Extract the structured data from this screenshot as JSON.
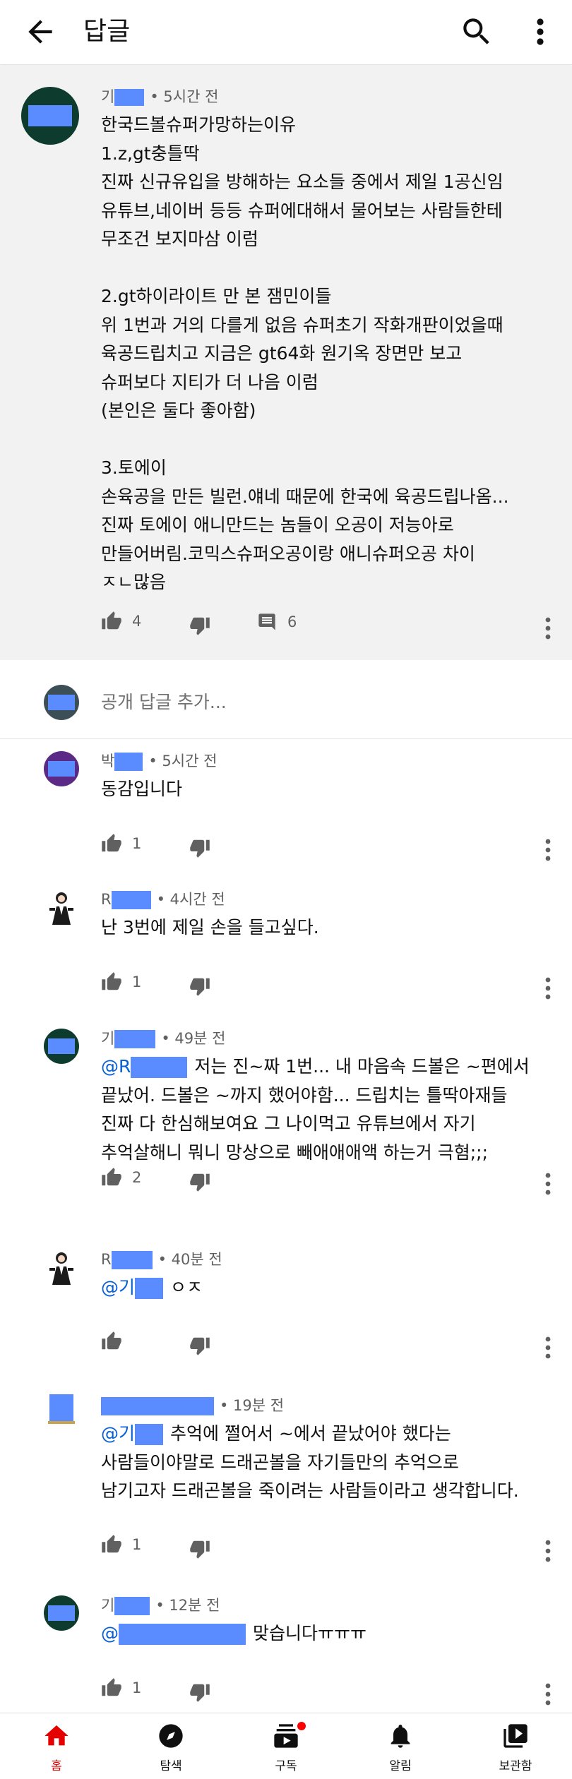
{
  "header": {
    "title": "답글"
  },
  "main_comment": {
    "author": "기",
    "time": "• 5시간 전",
    "lines": [
      "한국드볼슈퍼가망하는이유",
      "1.z,gt충틀딱",
      "진짜 신규유입을 방해하는 요소들 중에서 제일 1공신임",
      "유튜브,네이버 등등 슈퍼에대해서 물어보는 사람들한테",
      "무조건 보지마삼 이럼",
      "",
      "2.gt하이라이트 만 본 잼민이들",
      "위 1번과 거의 다를게 없음 슈퍼초기 작화개판이었을때",
      "육공드립치고 지금은 gt64화 원기옥 장면만 보고",
      "슈퍼보다 지티가 더 나음 이럼",
      "(본인은 둘다 좋아함)",
      "",
      "3.토에이",
      "손육공을 만든 빌런.얘네 때문에 한국에 육공드립나옴...",
      "진짜 토에이 애니만드는 놈들이 오공이 저능아로",
      "만들어버림.코믹스슈퍼오공이랑 애니슈퍼오공 차이",
      "ㅈㄴ많음"
    ],
    "likes": "4",
    "replies": "6"
  },
  "add_reply": {
    "placeholder": "공개 답글 추가..."
  },
  "replies": [
    {
      "author": "박",
      "time": "• 5시간 전",
      "mention": "",
      "text": [
        "동감입니다"
      ],
      "likes": "1"
    },
    {
      "author": "R",
      "time": "• 4시간 전",
      "mention": "",
      "text": [
        "난 3번에 제일 손을 들고싶다."
      ],
      "likes": "1"
    },
    {
      "author": "기",
      "time": "• 49분 전",
      "mention": "@R",
      "text": [
        "저는 진~짜 1번... 내 마음속 드볼은 ~편에서",
        "끝났어. 드볼은 ~까지 했어야함... 드립치는 틀딱아재들",
        "진짜 다 한심해보여요 그 나이먹고 유튜브에서 자기",
        "추억살해니 뭐니 망상으로 빼애애애액 하는거 극혐;;;"
      ],
      "likes": "2"
    },
    {
      "author": "R",
      "time": "• 40분 전",
      "mention": "@기",
      "text": [
        "ㅇㅈ"
      ],
      "likes": ""
    },
    {
      "author": "",
      "time": "• 19분 전",
      "mention": "@기",
      "text": [
        "추억에 쩔어서 ~에서 끝났어야 했다는",
        "사람들이야말로 드래곤볼을 자기들만의 추억으로",
        "남기고자 드래곤볼을 죽이려는 사람들이라고 생각합니다."
      ],
      "likes": "1"
    },
    {
      "author": "기",
      "time": "• 12분 전",
      "mention": "@",
      "text": [
        "맞습니다ㅠㅠㅠ"
      ],
      "likes": "1"
    }
  ],
  "bottom_nav": [
    {
      "label": "홈",
      "icon": "home-icon"
    },
    {
      "label": "탐색",
      "icon": "compass-icon"
    },
    {
      "label": "구독",
      "icon": "subscriptions-icon"
    },
    {
      "label": "알림",
      "icon": "bell-icon"
    },
    {
      "label": "보관함",
      "icon": "library-icon"
    }
  ],
  "colors": {
    "accent": "#e40000",
    "mention": "#065fd4",
    "redaction": "#5a8cff"
  }
}
